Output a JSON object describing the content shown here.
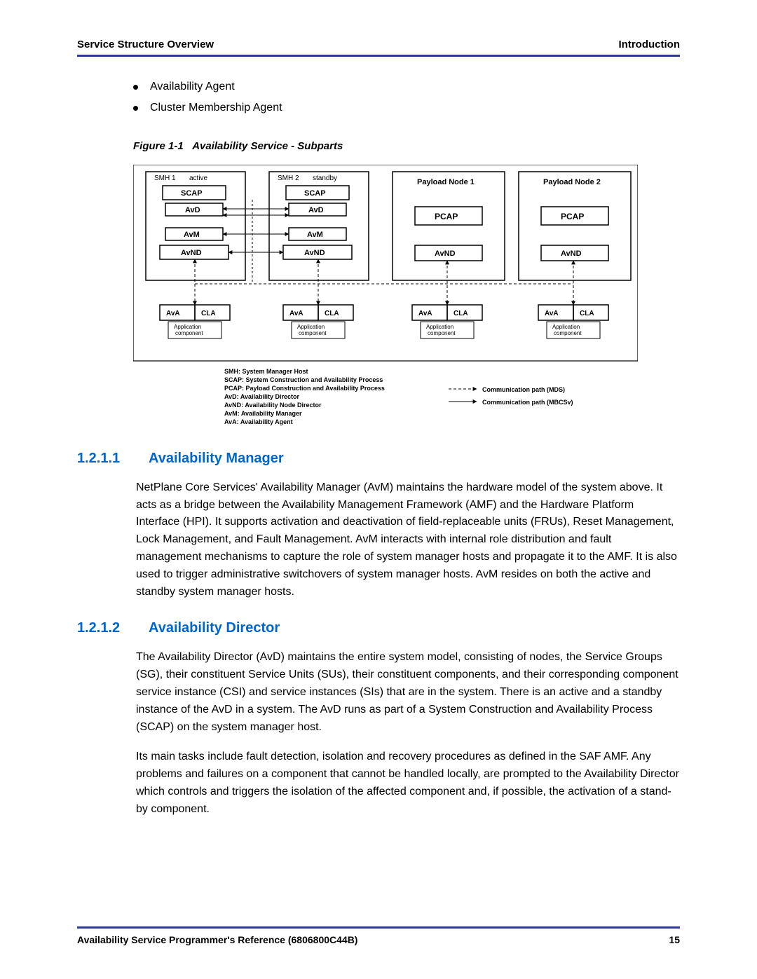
{
  "header": {
    "left": "Service Structure Overview",
    "right": "Introduction"
  },
  "bullets": [
    "Availability Agent",
    "Cluster Membership Agent"
  ],
  "figure": {
    "caption_prefix": "Figure 1-1",
    "caption_rest": "Availability Service - Subparts",
    "smh1": {
      "name": "SMH 1",
      "state": "active"
    },
    "smh2": {
      "name": "SMH 2",
      "state": "standby"
    },
    "scap": "SCAP",
    "avd": "AvD",
    "avm": "AvM",
    "avnd": "AvND",
    "ava": "AvA",
    "cla": "CLA",
    "app_top": "Application",
    "app_bot": "component",
    "payload1": "Payload Node 1",
    "payload2": "Payload Node 2",
    "pcap": "PCAP",
    "legend": {
      "l1": "SMH: System Manager Host",
      "l2": "SCAP: System Construction and Availability Process",
      "l3": "PCAP: Payload Construction and Availability Process",
      "l4": "AvD: Availability Director",
      "l5": "AvND: Availability Node Director",
      "l6": "AvM: Availability Manager",
      "l7": "AvA: Availability Agent",
      "r1": "Communication path (MDS)",
      "r2": "Communication path (MBCSv)"
    }
  },
  "sections": {
    "s1": {
      "num": "1.2.1.1",
      "title": "Availability Manager",
      "p1": "NetPlane Core Services' Availability Manager (AvM) maintains the hardware model of the system above. It acts as a bridge between the Availability Management Framework (AMF) and the Hardware Platform Interface (HPI). It supports activation and deactivation of field-replaceable units (FRUs), Reset Management, Lock Management, and Fault Management. AvM interacts with internal role distribution and fault management mechanisms to capture the role of system manager hosts and propagate it to the AMF. It is also used to trigger administrative switchovers of system manager hosts. AvM resides on both the active and standby system manager hosts."
    },
    "s2": {
      "num": "1.2.1.2",
      "title": "Availability Director",
      "p1": "The Availability Director (AvD) maintains the entire system model, consisting of nodes, the Service Groups (SG), their constituent Service Units (SUs), their constituent components, and their corresponding component service instance (CSI) and service instances (SIs) that are in the system. There is an active and a standby instance of the AvD in a system. The AvD runs as part of a System Construction and Availability Process (SCAP) on the system manager host.",
      "p2": "Its main tasks include fault detection, isolation and recovery procedures as defined in the SAF AMF. Any problems and failures on a component that cannot be handled locally, are prompted to the Availability Director which controls and triggers the isolation of the affected component and, if possible, the activation of a stand-by component."
    }
  },
  "footer": {
    "doc": "Availability Service Programmer's Reference (6806800C44B)",
    "page": "15"
  }
}
